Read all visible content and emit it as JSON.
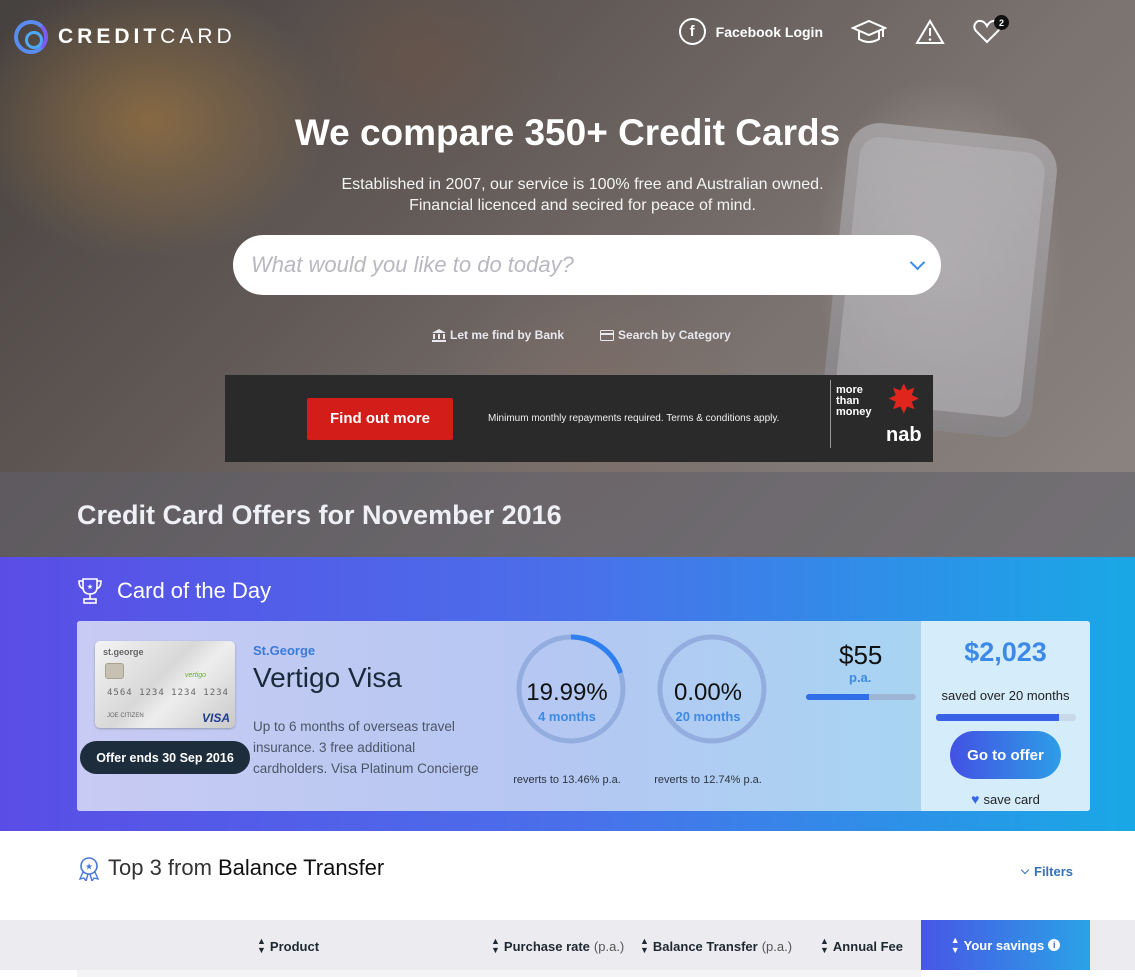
{
  "brand": {
    "name_bold": "CREDIT",
    "name_light": "CARD"
  },
  "nav": {
    "facebook_label": "Facebook Login",
    "facebook_glyph": "f",
    "wishlist_count": "2",
    "icons": [
      "facebook-icon",
      "graduation-cap-icon",
      "warning-icon",
      "heart-icon"
    ]
  },
  "hero": {
    "title": "We compare 350+ Credit Cards",
    "subtitle_line1": "Established in 2007, our service is 100% free and Australian owned.",
    "subtitle_line2": "Financial licenced and secired for peace of mind.",
    "search_placeholder": "What would you like to do today?",
    "link_bank": "Let me find by Bank",
    "link_category": "Search by Category"
  },
  "ad": {
    "button": "Find out more",
    "disclaimer": "Minimum monthly repayments required. Terms & conditions apply.",
    "brand_line1": "more",
    "brand_line2": "than",
    "brand_line3": "money",
    "brand_logo": "nab"
  },
  "offers_title": "Credit Card Offers for November 2016",
  "card_of_day": {
    "heading": "Card of the Day",
    "card_image": {
      "bank": "st.george",
      "number": "4564 1234 1234 1234",
      "holder": "JOE CITIZEN",
      "network": "VISA",
      "product": "vertigo"
    },
    "offer_ends": "Offer ends 30 Sep 2016",
    "bank": "St.George",
    "name": "Vertigo Visa",
    "description": "Up to 6 months of overseas travel insurance. 3 free additional cardholders. Visa Platinum Concierge",
    "purchase_rate": {
      "value": "19.99%",
      "period": "4 months",
      "reverts": "reverts to 13.46% p.a.",
      "progress": 0.2
    },
    "balance_transfer": {
      "value": "0.00%",
      "period": "20 months",
      "reverts": "reverts to 12.74% p.a.",
      "progress": 0.0
    },
    "annual_fee": {
      "value": "$55",
      "unit": "p.a.",
      "progress": 0.57
    },
    "savings": {
      "value": "$2,023",
      "label": "saved over 20 months",
      "progress": 0.88
    },
    "cta": "Go to offer",
    "save": "save card"
  },
  "top3": {
    "prefix": "Top 3 from",
    "category": "Balance Transfer",
    "filters": "Filters"
  },
  "table_header": {
    "product": "Product",
    "purchase_rate": "Purchase rate",
    "purchase_rate_unit": "(p.a.)",
    "balance_transfer": "Balance Transfer",
    "balance_transfer_unit": "(p.a.)",
    "annual_fee": "Annual Fee",
    "your_savings": "Your savings"
  },
  "colors": {
    "accent": "#3b8ae3",
    "gradient_start": "#5a4de6",
    "gradient_end": "#19a8e6",
    "ad_red": "#d21d18"
  }
}
